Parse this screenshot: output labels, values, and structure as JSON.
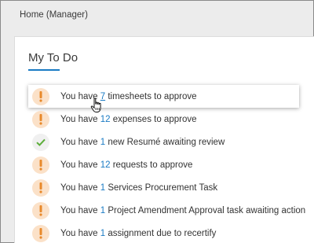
{
  "header": {
    "breadcrumb": "Home (Manager)"
  },
  "todo": {
    "title": "My To Do",
    "items": [
      {
        "icon": "exclamation-icon",
        "prefix": "You have ",
        "count": "7",
        "suffix": " timesheets to approve"
      },
      {
        "icon": "exclamation-icon",
        "prefix": "You have ",
        "count": "12",
        "suffix": " expenses to approve"
      },
      {
        "icon": "checkmark-icon",
        "prefix": "You have ",
        "count": "1",
        "suffix": " new Resumé awaiting review"
      },
      {
        "icon": "exclamation-icon",
        "prefix": "You have ",
        "count": "12",
        "suffix": " requests to approve"
      },
      {
        "icon": "exclamation-icon",
        "prefix": "You have ",
        "count": "1",
        "suffix": " Services Procurement Task"
      },
      {
        "icon": "exclamation-icon",
        "prefix": "You have ",
        "count": "1",
        "suffix": " Project Amendment Approval task awaiting action"
      },
      {
        "icon": "exclamation-icon",
        "prefix": "You have ",
        "count": "1",
        "suffix": " assignment due to recertify"
      }
    ]
  },
  "colors": {
    "accent": "#1a7bc4",
    "warning_badge": "#fbe1c8",
    "warning_mark": "#e8892a",
    "check_mark": "#5cae3a"
  }
}
